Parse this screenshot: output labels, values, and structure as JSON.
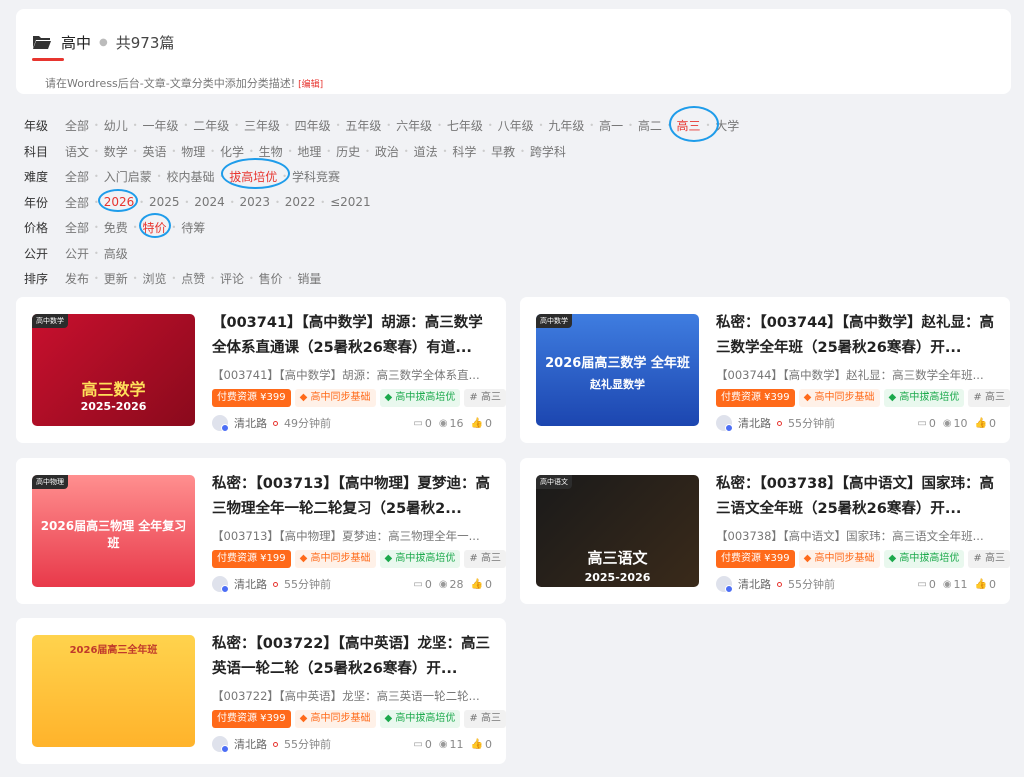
{
  "header": {
    "category": "高中",
    "count": "共973篇",
    "description": "请在Wordress后台-文章-文章分类中添加分类描述!",
    "edit_label": "[编辑]"
  },
  "filters": [
    {
      "label": "年级",
      "options": [
        "全部",
        "幼儿",
        "一年级",
        "二年级",
        "三年级",
        "四年级",
        "五年级",
        "六年级",
        "七年级",
        "八年级",
        "九年级",
        "高一",
        "高二",
        "高三",
        "大学"
      ],
      "active": 13
    },
    {
      "label": "科目",
      "options": [
        "语文",
        "数学",
        "英语",
        "物理",
        "化学",
        "生物",
        "地理",
        "历史",
        "政治",
        "道法",
        "科学",
        "早教",
        "跨学科"
      ],
      "active": -1
    },
    {
      "label": "难度",
      "options": [
        "全部",
        "入门启蒙",
        "校内基础",
        "拔高培优",
        "学科竞赛"
      ],
      "active": 3
    },
    {
      "label": "年份",
      "options": [
        "全部",
        "2026",
        "2025",
        "2024",
        "2023",
        "2022",
        "≤2021"
      ],
      "active": 1
    },
    {
      "label": "价格",
      "options": [
        "全部",
        "免费",
        "特价",
        "待筹"
      ],
      "active": 2
    },
    {
      "label": "公开",
      "options": [
        "公开",
        "高级"
      ],
      "active": -1
    },
    {
      "label": "排序",
      "options": [
        "发布",
        "更新",
        "浏览",
        "点赞",
        "评论",
        "售价",
        "销量"
      ],
      "active": -1
    }
  ],
  "posts": [
    {
      "title": "【003741】【高中数学】胡源：高三数学全体系直通课（25暑秋26寒春）有道...",
      "excerpt": "【003741】【高中数学】胡源：高三数学全体系直...",
      "price_tag": "付费资源 ¥399",
      "tag_sync": "高中同步基础",
      "tag_adv": "高中拔高培优",
      "tag_hash": "# 高三",
      "author": "清北路",
      "time": "49分钟前",
      "comments": "0",
      "views": "16",
      "likes": "0",
      "thumb_tag": "高中数学",
      "thumb_big": "高三数学",
      "thumb_sub": "2025-2026"
    },
    {
      "title": "私密：【003744】【高中数学】赵礼显：高三数学全年班（25暑秋26寒春）开...",
      "excerpt": "【003744】【高中数学】赵礼显：高三数学全年班...",
      "price_tag": "付费资源 ¥399",
      "tag_sync": "高中同步基础",
      "tag_adv": "高中拔高培优",
      "tag_hash": "# 高三",
      "author": "清北路",
      "time": "55分钟前",
      "comments": "0",
      "views": "10",
      "likes": "0",
      "thumb_tag": "高中数学",
      "thumb_big": "2026届高三数学 全年班",
      "thumb_sub": "赵礼显数学"
    },
    {
      "title": "私密：【003713】【高中物理】夏梦迪：高三物理全年一轮二轮复习（25暑秋2...",
      "excerpt": "【003713】【高中物理】夏梦迪：高三物理全年一...",
      "price_tag": "付费资源 ¥199",
      "tag_sync": "高中同步基础",
      "tag_adv": "高中拔高培优",
      "tag_hash": "# 高三",
      "author": "清北路",
      "time": "55分钟前",
      "comments": "0",
      "views": "28",
      "likes": "0",
      "thumb_tag": "高中物理",
      "thumb_big": "2026届高三物理 全年复习班",
      "thumb_sub": ""
    },
    {
      "title": "私密：【003738】【高中语文】国家玮：高三语文全年班（25暑秋26寒春）开...",
      "excerpt": "【003738】【高中语文】国家玮：高三语文全年班...",
      "price_tag": "付费资源 ¥399",
      "tag_sync": "高中同步基础",
      "tag_adv": "高中拔高培优",
      "tag_hash": "# 高三",
      "author": "清北路",
      "time": "55分钟前",
      "comments": "0",
      "views": "11",
      "likes": "0",
      "thumb_tag": "高中语文",
      "thumb_big": "高三语文",
      "thumb_sub": "2025-2026"
    },
    {
      "title": "私密：【003722】【高中英语】龙坚：高三英语一轮二轮（25暑秋26寒春）开...",
      "excerpt": "【003722】【高中英语】龙坚：高三英语一轮二轮...",
      "price_tag": "付费资源 ¥399",
      "tag_sync": "高中同步基础",
      "tag_adv": "高中拔高培优",
      "tag_hash": "# 高三",
      "author": "清北路",
      "time": "55分钟前",
      "comments": "0",
      "views": "11",
      "likes": "0",
      "thumb_tag": "",
      "thumb_big": "2026届高三全年班",
      "thumb_sub": ""
    }
  ]
}
